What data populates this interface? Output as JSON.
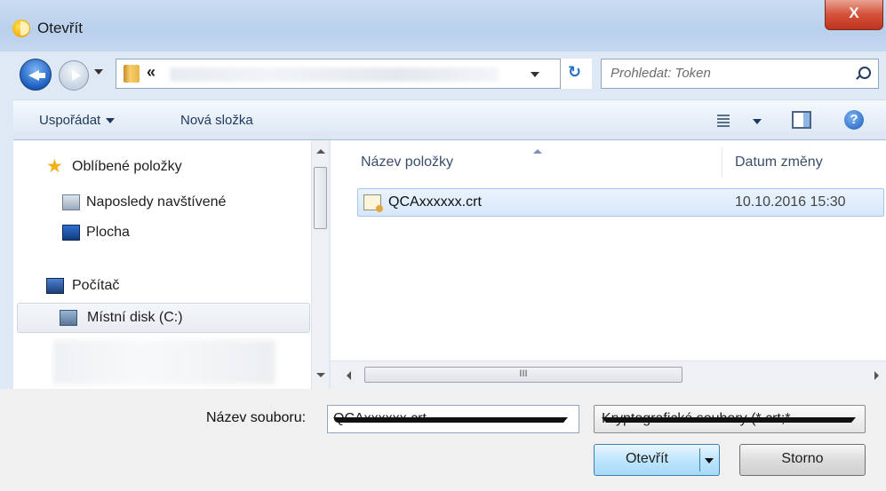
{
  "window": {
    "title": "Otevřít",
    "close_label": "X"
  },
  "address": {
    "chevrons": "«",
    "search_placeholder": "Prohledat: Token"
  },
  "toolbar": {
    "organize_label": "Uspořádat",
    "new_folder_label": "Nová složka",
    "help_label": "?"
  },
  "nav": {
    "favorites": "Oblíbené položky",
    "recent": "Naposledy navštívené",
    "desktop": "Plocha",
    "computer": "Počítač",
    "local_disk": "Místní disk (C:)"
  },
  "files": {
    "columns": {
      "name": "Název položky",
      "date": "Datum změny"
    },
    "rows": [
      {
        "name": "QCAxxxxxx.crt",
        "date": "10.10.2016 15:30"
      }
    ],
    "hscroll_grip": "III"
  },
  "bottom": {
    "filename_label": "Název souboru:",
    "filename_value": "QCAxxxxxx.crt",
    "filetype_value": "Kryptografické soubory (*.crt;*.",
    "open_label": "Otevřít",
    "cancel_label": "Storno"
  }
}
